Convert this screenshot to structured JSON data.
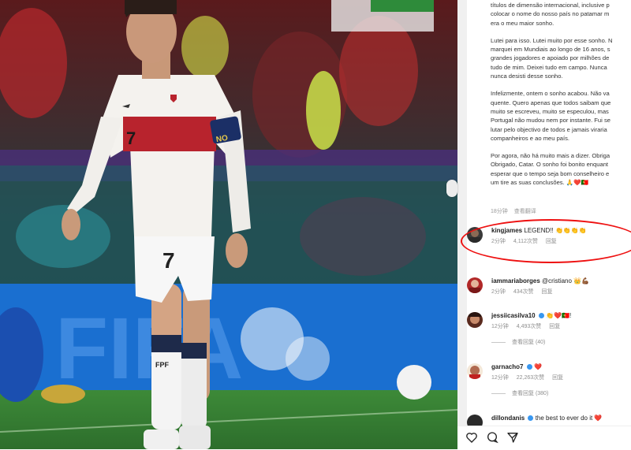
{
  "photo": {
    "shirt_number": "7",
    "armband_text": "NO",
    "shorts_number": "7",
    "board_text": "FIFA",
    "sock_text": "FPF"
  },
  "caption": {
    "p1": [
      "títulos de dimensão internacional, inclusive p",
      "colocar o nome do nosso país no patamar m",
      "era o meu maior sonho."
    ],
    "p2": [
      "Lutei para isso. Lutei muito por esse sonho. N",
      "marquei em Mundiais ao longo de 16 anos, s",
      "grandes jogadores e apoiado por milhões de",
      "tudo de mim. Deixei tudo em campo. Nunca",
      "nunca desisti desse sonho."
    ],
    "p3": [
      "Infelizmente, ontem o sonho acabou. Não va",
      "quente. Quero apenas que todos saibam que",
      "muito se escreveu, muito se especulou, mas",
      "Portugal não mudou nem por instante. Fui se",
      "lutar pelo objectivo de todos e jamais viraria",
      "companheiros e ao meu país."
    ],
    "p4": [
      "Por agora, não há muito mais a dizer. Obriga",
      "Obrigado, Catar. O sonho foi bonito enquant",
      "esperar que o tempo seja bom conselheiro e",
      "um tire as suas conclusões. 🙏❤️🇵🇹"
    ],
    "time": "18分钟",
    "translate": "查看翻译"
  },
  "comments": [
    {
      "username": "kingjames",
      "text": "LEGEND!! 👏👏👏👏",
      "time": "2分钟",
      "likes": "4,112次赞",
      "reply": "回复",
      "verified": false
    },
    {
      "username": "iammariaborges",
      "text": "@cristiano 👑💪🏾",
      "time": "2分钟",
      "likes": "434次赞",
      "reply": "回复",
      "verified": false
    },
    {
      "username": "jessiicasilva10",
      "text": "👏❤️🇵🇹!",
      "time": "12分钟",
      "likes": "4,493次赞",
      "reply": "回复",
      "verified": true,
      "replies": "查看回复 (40)"
    },
    {
      "username": "garnacho7",
      "text": "❤️",
      "time": "12分钟",
      "likes": "22,263次赞",
      "reply": "回复",
      "verified": true,
      "replies": "查看回复 (380)"
    },
    {
      "username": "dillondanis",
      "text": "the best to ever do it ❤️",
      "verified": true
    }
  ],
  "colors": {
    "accent_red": "#e11111",
    "verified_blue": "#3897f0",
    "heart": "#e0245e"
  },
  "icons": [
    "heart-outline-icon",
    "comment-icon",
    "share-icon",
    "like-icon"
  ]
}
